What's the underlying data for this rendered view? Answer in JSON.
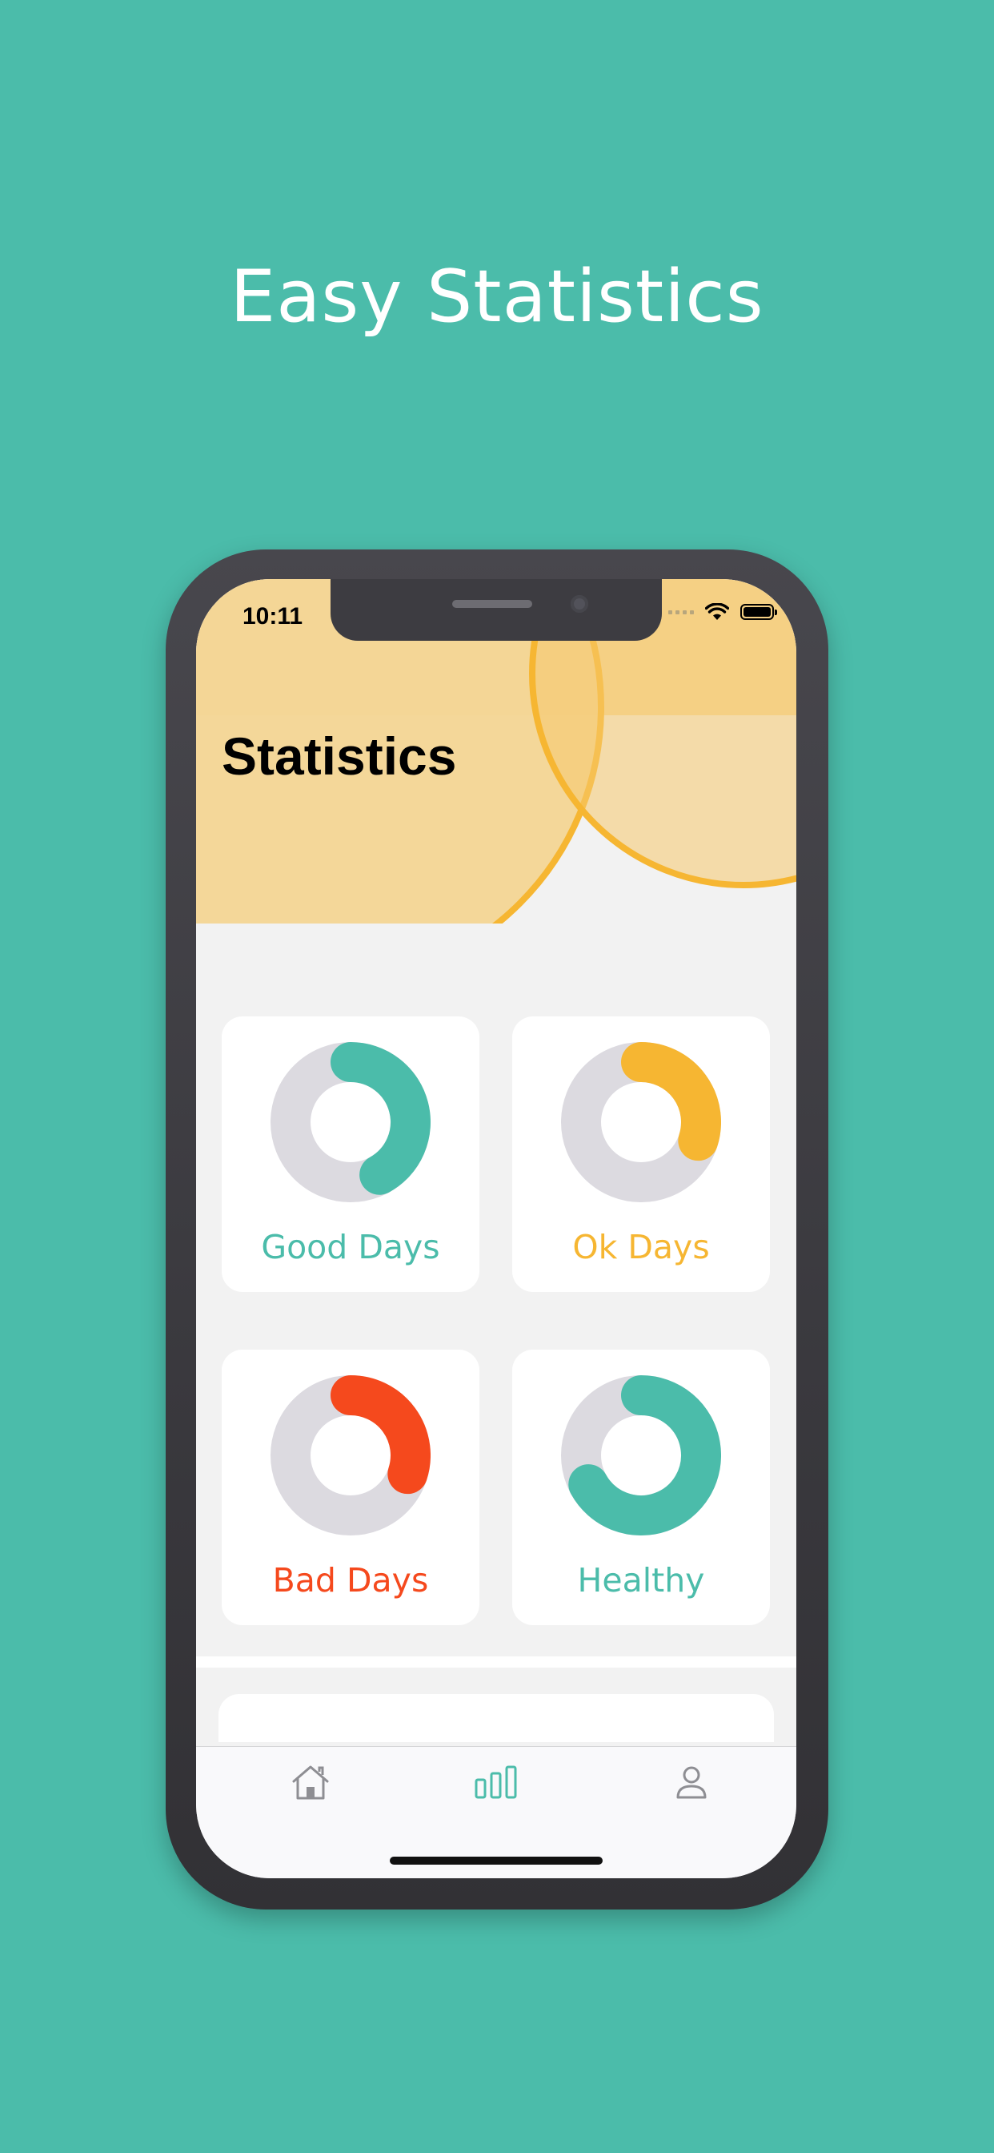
{
  "headline": "Easy Statistics",
  "status_bar": {
    "time": "10:11"
  },
  "page_title": "Statistics",
  "colors": {
    "background": "#4bbcaa",
    "header": "#f4d9a0",
    "header_ring": "#f6b632",
    "ring_track": "#dcdae0",
    "good": "#4bbcaa",
    "ok": "#f6b632",
    "bad": "#f5491d",
    "healthy": "#4bbcaa"
  },
  "cards": [
    {
      "label": "Good Days",
      "progress": 0.42,
      "color": "#4bbcaa"
    },
    {
      "label": "Ok Days",
      "progress": 0.3,
      "color": "#f6b632"
    },
    {
      "label": "Bad Days",
      "progress": 0.3,
      "color": "#f5491d"
    },
    {
      "label": "Healthy",
      "progress": 0.67,
      "color": "#4bbcaa"
    }
  ],
  "tabbar": {
    "items": [
      {
        "icon": "home-icon",
        "active": false
      },
      {
        "icon": "bar-chart-icon",
        "active": true
      },
      {
        "icon": "person-icon",
        "active": false
      }
    ]
  }
}
